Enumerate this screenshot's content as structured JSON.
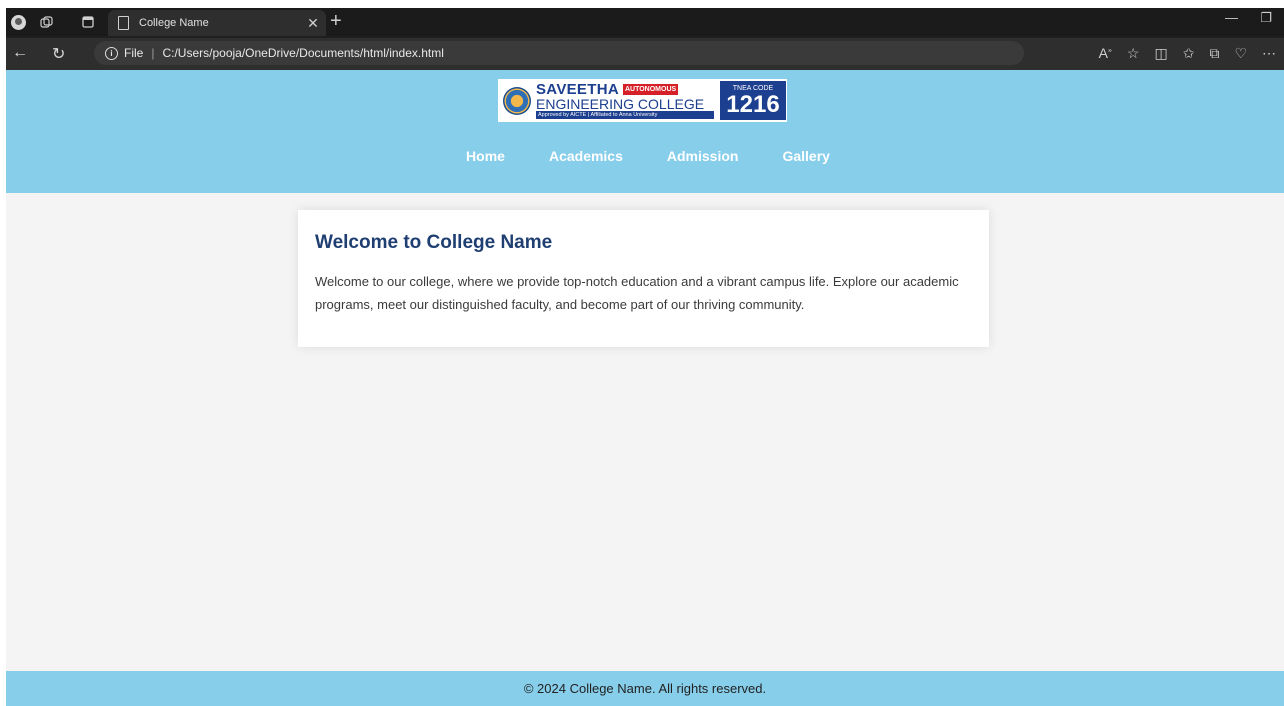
{
  "browser": {
    "tab_title": "College Name",
    "address": {
      "file_label": "File",
      "separator": "|",
      "path": "C:/Users/pooja/OneDrive/Documents/html/index.html"
    },
    "icons": [
      "profile-icon",
      "workspaces-icon",
      "tab-actions-icon",
      "document-icon",
      "close-icon",
      "new-tab-icon",
      "minimize-icon",
      "restore-icon",
      "back-icon",
      "refresh-icon",
      "info-icon",
      "read-aloud-icon",
      "favorite-icon",
      "split-screen-icon",
      "favorites-icon",
      "collections-icon",
      "browser-essentials-icon",
      "more-icon"
    ]
  },
  "logo": {
    "name_line1": "SAVEETHA",
    "badge": "AUTONOMOUS",
    "name_line2": "ENGINEERING COLLEGE",
    "approved": "Approved by AICTE | Affiliated to Anna University",
    "code_label": "TNEA CODE",
    "code_number": "1216"
  },
  "nav": {
    "items": [
      "Home",
      "Academics",
      "Admission",
      "Gallery"
    ]
  },
  "main": {
    "title": "Welcome to College Name",
    "paragraph": "Welcome to our college, where we provide top-notch education and a vibrant campus life. Explore our academic programs, meet our distinguished faculty, and become part of our thriving community."
  },
  "footer": {
    "text": "© 2024 College Name. All rights reserved."
  },
  "colors": {
    "header_bg": "#87ceeb",
    "page_bg": "#f4f4f4",
    "title_color": "#1f3f72"
  }
}
